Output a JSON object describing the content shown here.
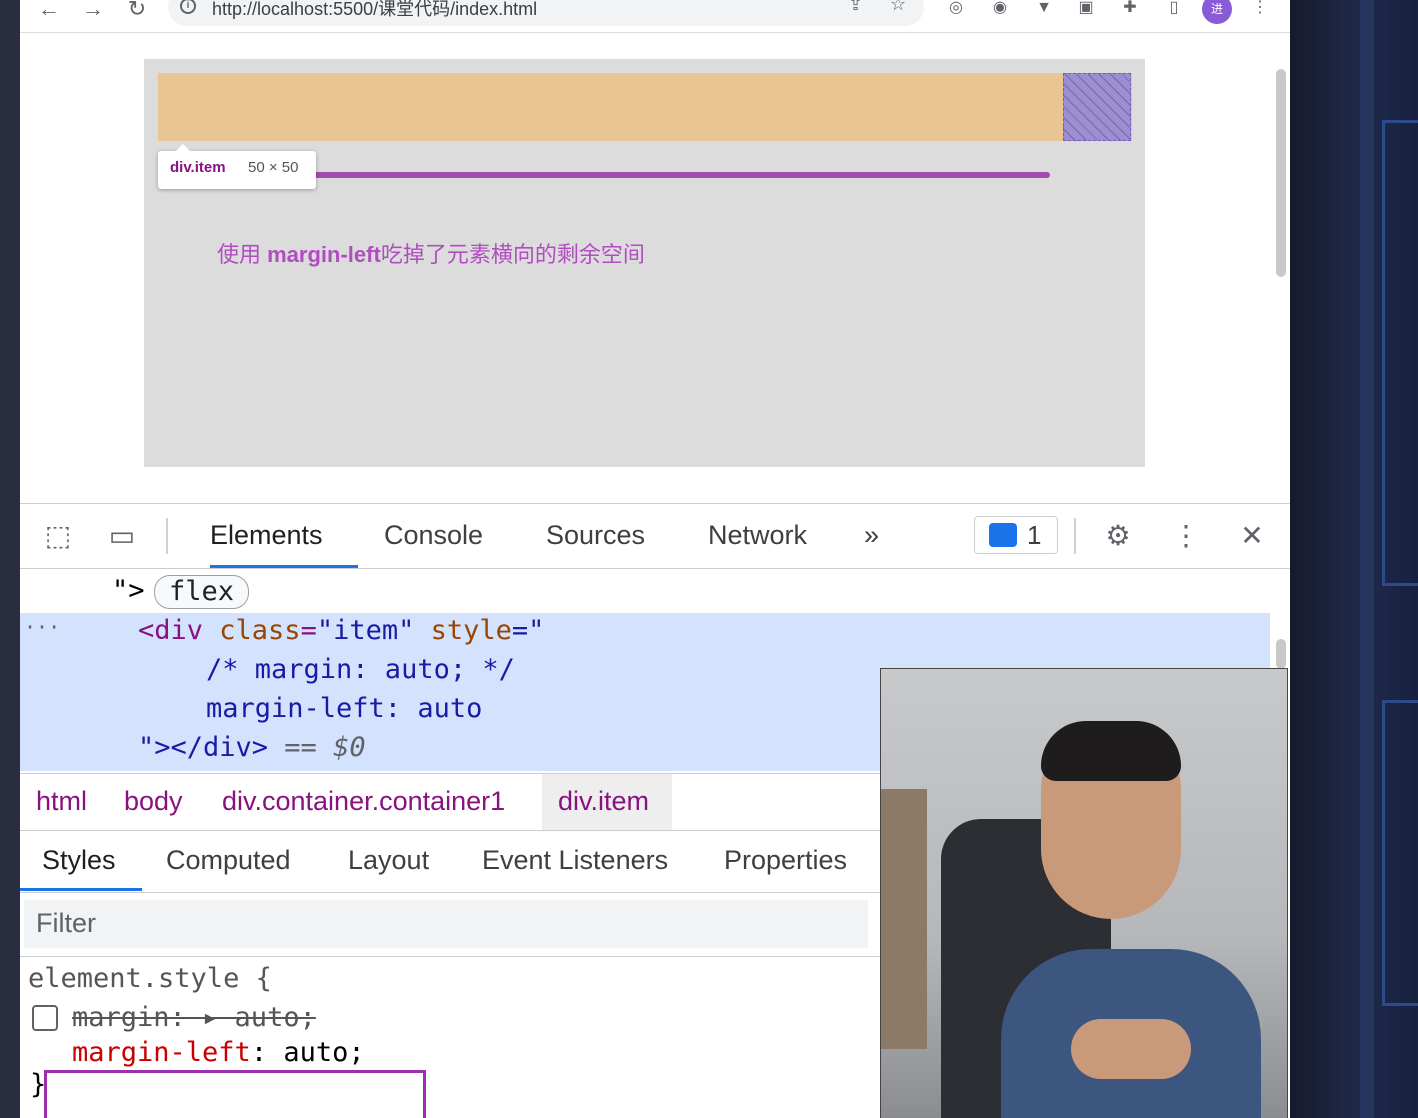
{
  "browser": {
    "url": "http://localhost:5500/课堂代码/index.html",
    "profile_initial": "进",
    "icons": [
      "back-icon",
      "forward-icon",
      "reload-icon",
      "info-icon",
      "share-icon",
      "star-icon",
      "extension-icon",
      "puzzle-icon",
      "sidepanel-icon",
      "more-icon"
    ]
  },
  "page": {
    "tooltip_name": "div.item",
    "tooltip_size": "50 × 50",
    "note_prefix": "使用 ",
    "note_bold": "margin-left",
    "note_suffix": "吃掉了元素横向的剩余空间"
  },
  "devtools": {
    "tabs": [
      "Elements",
      "Console",
      "Sources",
      "Network"
    ],
    "active_tab": "Elements",
    "more_tabs": "»",
    "issues_count": "1",
    "tree": {
      "line0_close": "\">",
      "flex_pill": "flex",
      "ellipsis": "···",
      "line1_open": "<div ",
      "line1_attr1": "class",
      "line1_eq1": "=",
      "line1_val1": "\"item\"",
      "line1_attr2": " style",
      "line1_eq2": "=\"",
      "line2": "/* margin: auto; */",
      "line3": "margin-left: auto",
      "line4_close": "\"></div>",
      "line4_eq": " == ",
      "line4_var": "$0"
    },
    "breadcrumbs": [
      "html",
      "body",
      "div.container.container1",
      "div.item"
    ],
    "sub_tabs": [
      "Styles",
      "Computed",
      "Layout",
      "Event Listeners",
      "Properties"
    ],
    "filter_placeholder": "Filter",
    "styles": {
      "selector": "element.style {",
      "rule1": "margin: ▸ auto;",
      "rule2_prop": "margin-left",
      "rule2_val": ": auto;",
      "close": "}"
    }
  },
  "colors": {
    "container": "#e8c592",
    "item_highlight": "#9b8fd0",
    "annotation": "#b04ec0",
    "accent": "#1a73e8"
  }
}
